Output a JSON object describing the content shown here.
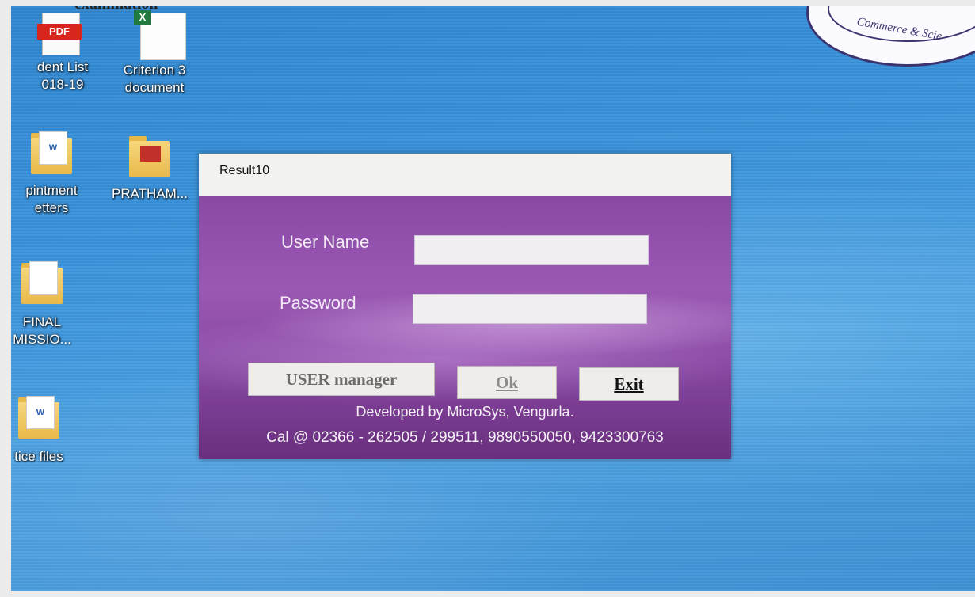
{
  "desktop": {
    "top_text": "examination",
    "stamp_text": "Commerce & Scie",
    "icons": [
      {
        "label_line1": "dent List",
        "label_line2": "018-19",
        "icon": "pdf-icon",
        "icon_text": "PDF"
      },
      {
        "label_line1": "Criterion 3",
        "label_line2": "document",
        "icon": "excel-icon",
        "icon_text": "X"
      },
      {
        "label_line1": "pintment",
        "label_line2": "etters",
        "icon": "folder-icon",
        "icon_text": "W"
      },
      {
        "label_line1": "PRATHAM...",
        "label_line2": "",
        "icon": "folder-icon"
      },
      {
        "label_line1": "FINAL",
        "label_line2": "MISSIO...",
        "icon": "folder-icon"
      },
      {
        "label_line1": "tice files",
        "label_line2": "",
        "icon": "folder-icon",
        "icon_text": "W"
      }
    ]
  },
  "dialog": {
    "title": "Result10",
    "username_label": "User Name",
    "username_value": "",
    "password_label": "Password",
    "password_value": "",
    "buttons": {
      "user_manager": "USER manager",
      "ok": "Ok",
      "exit": "Exit"
    },
    "footer_line1": "Developed by MicroSys, Vengurla.",
    "footer_line2": "Cal @ 02366 - 262505 / 299511, 9890550050, 9423300763"
  },
  "colors": {
    "desktop_blue": "#3a93db",
    "dialog_purple": "#8a4aa4",
    "titlebar": "#f2f2ee"
  }
}
